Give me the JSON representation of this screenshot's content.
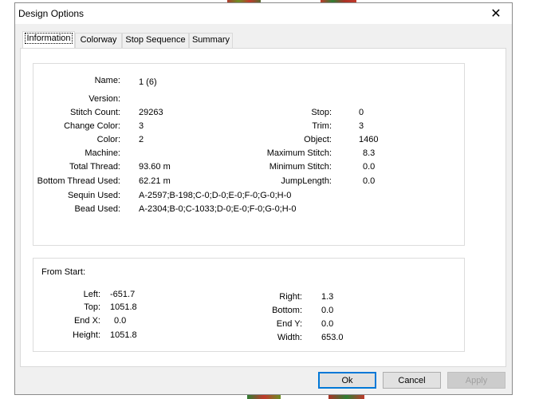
{
  "window": {
    "title": "Design Options",
    "close_glyph": "✕"
  },
  "tabs": [
    "Information",
    "Colorway",
    "Stop Sequence",
    "Summary"
  ],
  "info": {
    "name_label": "Name:",
    "name_value": "1 (6)",
    "version_label": "Version:",
    "stitch_count_label": "Stitch Count:",
    "stitch_count_value": "29263",
    "change_color_label": "Change Color:",
    "change_color_value": "3",
    "color_label": "Color:",
    "color_value": "2",
    "machine_label": "Machine:",
    "total_thread_label": "Total Thread:",
    "total_thread_value": "93.60 m",
    "bottom_thread_label": "Bottom Thread Used:",
    "bottom_thread_value": "62.21 m",
    "sequin_label": "Sequin Used:",
    "sequin_value": "A-2597;B-198;C-0;D-0;E-0;F-0;G-0;H-0",
    "bead_label": "Bead Used:",
    "bead_value": "A-2304;B-0;C-1033;D-0;E-0;F-0;G-0;H-0",
    "stop_label": "Stop:",
    "stop_value": "0",
    "trim_label": "Trim:",
    "trim_value": "3",
    "object_label": "Object:",
    "object_value": "1460",
    "max_stitch_label": "Maximum Stitch:",
    "max_stitch_value": "8.3",
    "min_stitch_label": "Minimum Stitch:",
    "min_stitch_value": "0.0",
    "jump_length_label": "JumpLength:",
    "jump_length_value": "0.0"
  },
  "from_start": {
    "heading": "From Start:",
    "left_label": "Left:",
    "left_value": "-651.7",
    "top_label": "Top:",
    "top_value": "1051.8",
    "endx_label": "End X:",
    "endx_value": "0.0",
    "height_label": "Height:",
    "height_value": "1051.8",
    "right_label": "Right:",
    "right_value": "1.3",
    "bottom_label": "Bottom:",
    "bottom_value": "0.0",
    "endy_label": "End Y:",
    "endy_value": "0.0",
    "width_label": "Width:",
    "width_value": "653.0"
  },
  "buttons": {
    "ok": "Ok",
    "cancel": "Cancel",
    "apply": "Apply"
  },
  "colors": {
    "accent": "#0078d7",
    "dialog_bg": "#f0f0f0",
    "artifact_red": "#c0392b",
    "artifact_green": "#2e7d32"
  }
}
